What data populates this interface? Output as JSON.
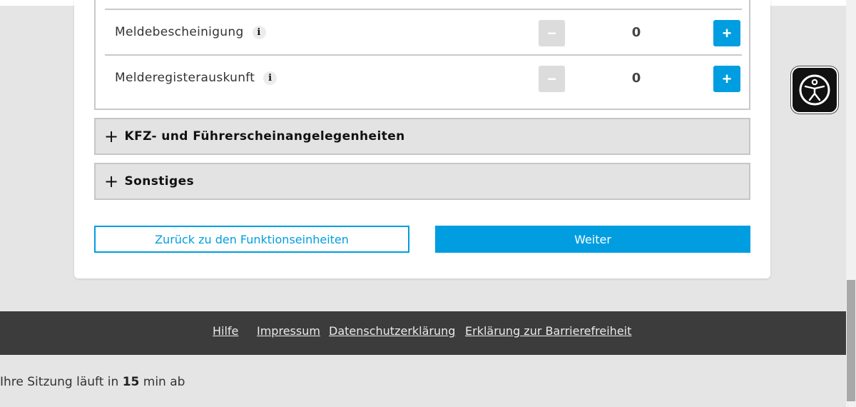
{
  "services": [
    {
      "label": "Meldebescheinigung",
      "count": "0",
      "minus": "−",
      "plus": "+",
      "info": "i"
    },
    {
      "label": "Melderegisterauskunft",
      "count": "0",
      "minus": "−",
      "plus": "+",
      "info": "i"
    }
  ],
  "accordions": [
    {
      "icon": "+",
      "label": "KFZ- und Führerscheinangelegenheiten"
    },
    {
      "icon": "+",
      "label": "Sonstiges"
    }
  ],
  "buttons": {
    "back": "Zurück zu den Funktionseinheiten",
    "next": "Weiter"
  },
  "footer": {
    "links": [
      "Hilfe",
      "Impressum",
      "Datenschutzerklärung",
      "Erklärung zur Barrierefreiheit"
    ]
  },
  "session": {
    "prefix": "Ihre Sitzung läuft in",
    "minutes": "15",
    "suffix": "min ab"
  },
  "colors": {
    "accent": "#009ee0",
    "footer_bg": "#3c3c3c",
    "page_bg": "#e5e5e5"
  },
  "icons": {
    "accessibility": "accessibility-person-icon",
    "info": "info-icon"
  }
}
